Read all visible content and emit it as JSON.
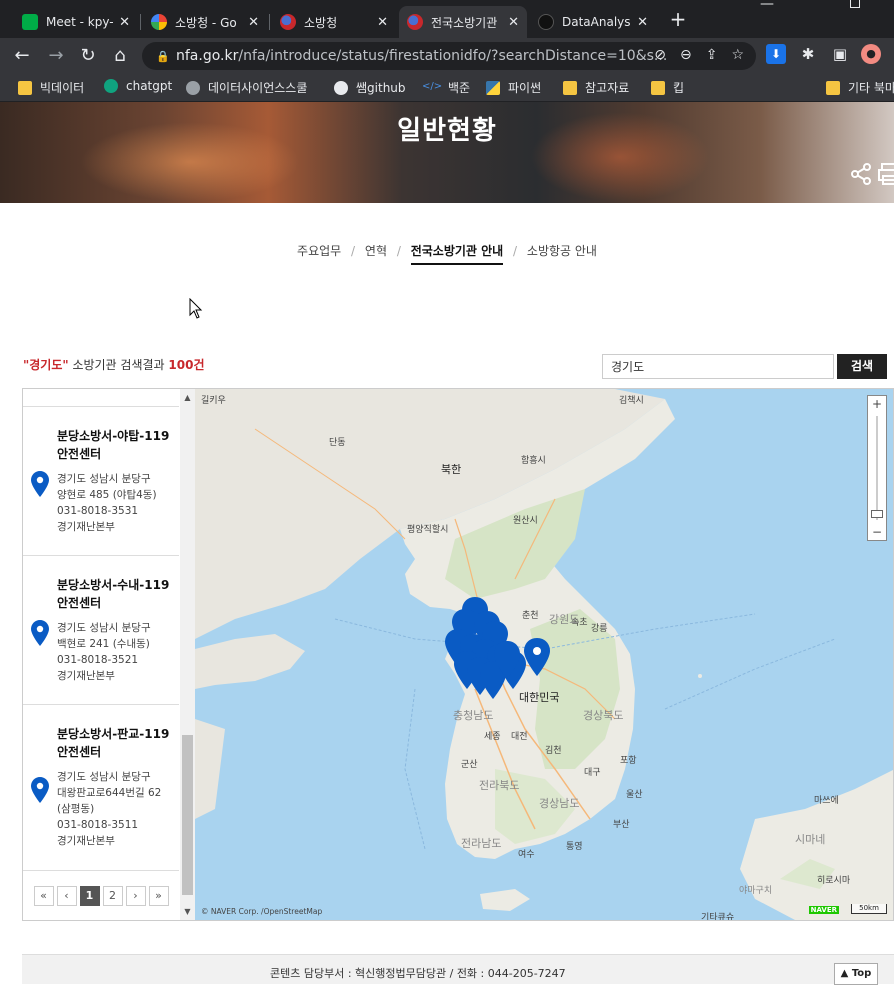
{
  "browser": {
    "tabs": [
      {
        "title": "Meet - kpy-",
        "icon": "meet-icon",
        "color": "#00ac47"
      },
      {
        "title": "소방청 - Go",
        "icon": "google-icon",
        "color": "#4285f4"
      },
      {
        "title": "소방청",
        "icon": "nfa-icon",
        "color": "#c8282c"
      },
      {
        "title": "전국소방기관",
        "icon": "nfa-icon",
        "color": "#c8282c"
      },
      {
        "title": "DataAnalysi",
        "icon": "github-icon",
        "color": "#333333"
      }
    ],
    "url_host": "nfa.go.kr",
    "url_path": "/nfa/introduce/status/firestationidfo/?searchDistance=10&s...",
    "bookmarks": [
      "빅데이터",
      "chatgpt",
      "데이터사이언스스쿨",
      "쌤github",
      "백준",
      "파이썬",
      "참고자료",
      "킵",
      "기타 북마"
    ]
  },
  "page": {
    "hero_title": "일반현황",
    "subnav": [
      "주요업무",
      "연혁",
      "전국소방기관 안내",
      "소방항공 안내"
    ],
    "result_keyword": "\"경기도\"",
    "result_text": " 소방기관 검색결과 ",
    "result_count": "100건",
    "search_value": "경기도",
    "search_button": "검색"
  },
  "stations": [
    {
      "name": "분당소방서-야탑-119 안전센터",
      "lines": [
        "경기도 성남시 분당구",
        "양현로 485 (야탑4동)",
        "031-8018-3531",
        "경기재난본부"
      ]
    },
    {
      "name": "분당소방서-수내-119 안전센터",
      "lines": [
        "경기도 성남시 분당구",
        "백현로 241 (수내동)",
        "031-8018-3521",
        "경기재난본부"
      ]
    },
    {
      "name": "분당소방서-판교-119 안전센터",
      "lines": [
        "경기도 성남시 분당구",
        "대왕판교로644번길 62",
        "(삼평동)",
        "031-8018-3511",
        "경기재난본부"
      ]
    }
  ],
  "pager": {
    "first": "«",
    "prev": "‹",
    "pages": [
      "1",
      "2"
    ],
    "next": "›",
    "last": "»"
  },
  "map": {
    "labels": [
      "길키우",
      "김책시",
      "단동",
      "북한",
      "함흥시",
      "평양직할시",
      "원산시",
      "속초",
      "춘천",
      "강원도",
      "강릉",
      "대한민국",
      "충청남도",
      "경상북도",
      "세종",
      "대전",
      "군산",
      "김천",
      "전라북도",
      "대구",
      "포항",
      "울산",
      "경상남도",
      "전라남도",
      "부산",
      "여수",
      "통영",
      "마쓰에",
      "히로시마",
      "야마구치",
      "기타큐슈",
      "시마네"
    ],
    "copyright": "© NAVER Corp. /OpenStreetMap",
    "brand": "NAVER",
    "scale": "50km",
    "zoom_in": "+",
    "zoom_out": "−",
    "pin_color": "#0a5bc4"
  },
  "footer": {
    "text": "콘텐츠 담당부서 : 혁신행정법무담당관      /      전화 : 044-205-7247",
    "top_button": "▲ Top"
  }
}
